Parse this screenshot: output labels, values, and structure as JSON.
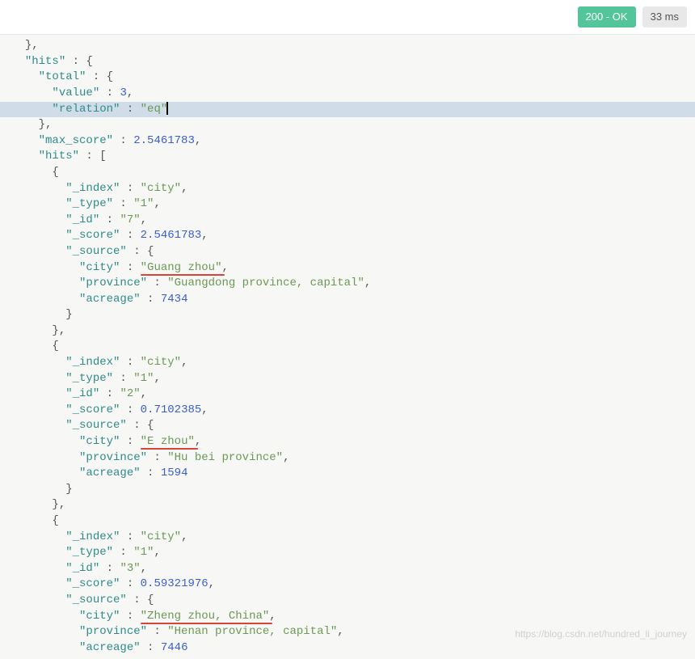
{
  "status": {
    "code_label": "200 - OK",
    "time_label": "33 ms"
  },
  "chart_data": {
    "type": "json-response",
    "hits": {
      "total": {
        "value": 3,
        "relation": "eq"
      },
      "max_score": 2.5461783,
      "hits": [
        {
          "_index": "city",
          "_type": "1",
          "_id": "7",
          "_score": 2.5461783,
          "_source": {
            "city": "Guang zhou",
            "province": "Guangdong province, capital",
            "acreage": 7434
          }
        },
        {
          "_index": "city",
          "_type": "1",
          "_id": "2",
          "_score": 0.7102385,
          "_source": {
            "city": "E zhou",
            "province": "Hu bei province",
            "acreage": 1594
          }
        },
        {
          "_index": "city",
          "_type": "1",
          "_id": "3",
          "_score": 0.59321976,
          "_source": {
            "city": "Zheng zhou, China",
            "province": "Henan province, capital",
            "acreage": 7446
          }
        }
      ]
    }
  },
  "code": {
    "l01": "},",
    "l02_k": "\"hits\"",
    "l02_r": " : {",
    "l03_k": "\"total\"",
    "l03_r": " : {",
    "l04_k": "\"value\"",
    "l04_v": "3",
    "l05_k": "\"relation\"",
    "l05_v": "\"eq\"",
    "l06": "},",
    "l07_k": "\"max_score\"",
    "l07_v": "2.5461783",
    "l08_k": "\"hits\"",
    "l08_r": " : [",
    "l09": "{",
    "l10_k": "\"_index\"",
    "l10_v": "\"city\"",
    "l11_k": "\"_type\"",
    "l11_v": "\"1\"",
    "l12_k": "\"_id\"",
    "l12_v": "\"7\"",
    "l13_k": "\"_score\"",
    "l13_v": "2.5461783",
    "l14_k": "\"_source\"",
    "l14_r": " : {",
    "l15_k": "\"city\"",
    "l15_v": "\"Guang zhou\"",
    "l16_k": "\"province\"",
    "l16_v": "\"Guangdong province, capital\"",
    "l17_k": "\"acreage\"",
    "l17_v": "7434",
    "l18": "}",
    "l19": "},",
    "l20": "{",
    "l21_k": "\"_index\"",
    "l21_v": "\"city\"",
    "l22_k": "\"_type\"",
    "l22_v": "\"1\"",
    "l23_k": "\"_id\"",
    "l23_v": "\"2\"",
    "l24_k": "\"_score\"",
    "l24_v": "0.7102385",
    "l25_k": "\"_source\"",
    "l25_r": " : {",
    "l26_k": "\"city\"",
    "l26_v": "\"E zhou\"",
    "l27_k": "\"province\"",
    "l27_v": "\"Hu bei province\"",
    "l28_k": "\"acreage\"",
    "l28_v": "1594",
    "l29": "}",
    "l30": "},",
    "l31": "{",
    "l32_k": "\"_index\"",
    "l32_v": "\"city\"",
    "l33_k": "\"_type\"",
    "l33_v": "\"1\"",
    "l34_k": "\"_id\"",
    "l34_v": "\"3\"",
    "l35_k": "\"_score\"",
    "l35_v": "0.59321976",
    "l36_k": "\"_source\"",
    "l36_r": " : {",
    "l37_k": "\"city\"",
    "l37_v": "\"Zheng zhou, China\"",
    "l38_k": "\"province\"",
    "l38_v": "\"Henan province, capital\"",
    "l39_k": "\"acreage\"",
    "l39_v": "7446"
  },
  "watermark": "https://blog.csdn.net/hundred_li_journey"
}
